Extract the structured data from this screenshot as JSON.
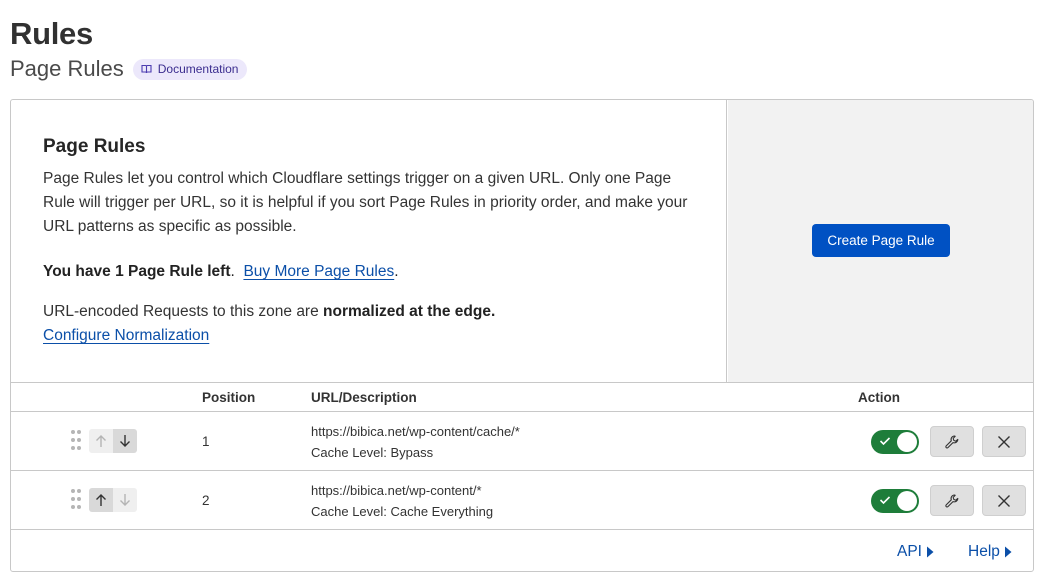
{
  "header": {
    "title": "Rules",
    "subtitle": "Page Rules",
    "doc_label": "Documentation"
  },
  "info": {
    "title": "Page Rules",
    "description": "Page Rules let you control which Cloudflare settings trigger on a given URL. Only one Page Rule will trigger per URL, so it is helpful if you sort Page Rules in priority order, and make your URL patterns as specific as possible.",
    "rules_left": "You have 1 Page Rule left",
    "rules_left_suffix": ".",
    "buy_more": "Buy More Page Rules",
    "buy_more_suffix": ".",
    "normalized_prefix": "URL-encoded Requests to this zone are ",
    "normalized_bold": "normalized at the edge.",
    "configure_link": "Configure Normalization"
  },
  "actions": {
    "create_label": "Create Page Rule"
  },
  "table": {
    "columns": {
      "position": "Position",
      "url": "URL/Description",
      "action": "Action"
    },
    "rows": [
      {
        "position": "1",
        "url": "https://bibica.net/wp-content/cache/*",
        "description": "Cache Level: Bypass",
        "enabled": true,
        "up_enabled": false,
        "down_enabled": true
      },
      {
        "position": "2",
        "url": "https://bibica.net/wp-content/*",
        "description": "Cache Level: Cache Everything",
        "enabled": true,
        "up_enabled": true,
        "down_enabled": false
      }
    ]
  },
  "footer": {
    "api": "API",
    "help": "Help"
  },
  "icons": {
    "doc": "book-icon",
    "drag": "drag-handle-icon",
    "up": "arrow-up-icon",
    "down": "arrow-down-icon",
    "check": "check-icon",
    "edit": "wrench-icon",
    "delete": "close-icon",
    "caret": "caret-right-icon"
  },
  "colors": {
    "primary": "#0051c3",
    "link": "#0b4fa8",
    "toggle_on": "#1e7d3a",
    "badge_bg": "#ece8fb"
  }
}
